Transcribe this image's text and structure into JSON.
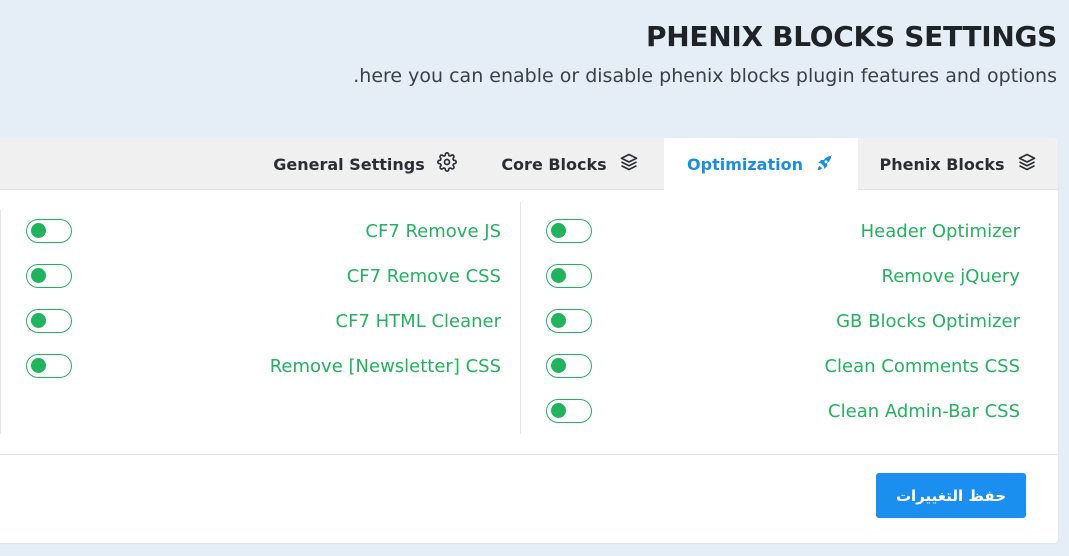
{
  "header": {
    "title": "PHENIX BLOCKS SETTINGS",
    "subtitle": ".here you can enable or disable phenix blocks plugin features and options"
  },
  "tabs": [
    {
      "label": "General Settings",
      "icon": "gear-icon",
      "active": false
    },
    {
      "label": "Core Blocks",
      "icon": "layers-icon",
      "active": false
    },
    {
      "label": "Optimization",
      "icon": "rocket-icon",
      "active": true
    },
    {
      "label": "Phenix Blocks",
      "icon": "layers-icon",
      "active": false
    }
  ],
  "right_options": [
    {
      "label": "Header Optimizer",
      "enabled": false
    },
    {
      "label": "Remove jQuery",
      "enabled": false
    },
    {
      "label": "GB Blocks Optimizer",
      "enabled": false
    },
    {
      "label": "Clean Comments CSS",
      "enabled": false
    },
    {
      "label": "Clean Admin-Bar CSS",
      "enabled": false
    }
  ],
  "left_options": [
    {
      "label": "CF7 Remove JS",
      "enabled": false
    },
    {
      "label": "CF7 Remove CSS",
      "enabled": false
    },
    {
      "label": "CF7 HTML Cleaner",
      "enabled": false
    },
    {
      "label": "Remove [Newsletter] CSS",
      "enabled": false
    }
  ],
  "save_label": "حفظ التغييرات",
  "colors": {
    "accent_green": "#22b35e",
    "accent_blue": "#1a8fe0",
    "button_blue": "#1a8ff0",
    "page_bg": "#e5eef7"
  }
}
